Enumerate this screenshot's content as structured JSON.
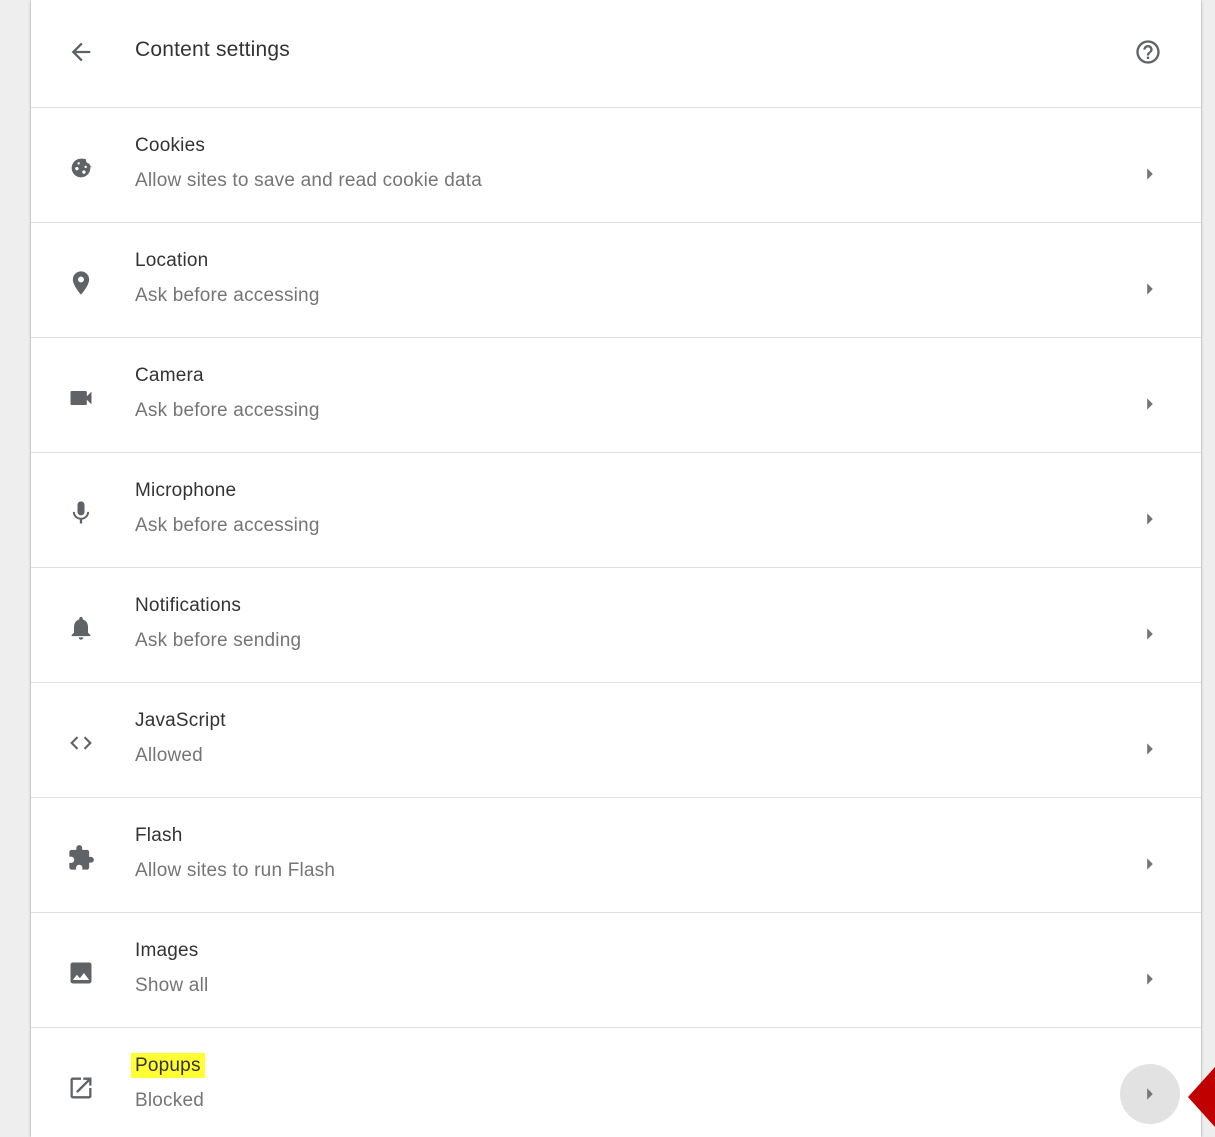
{
  "header": {
    "title": "Content settings",
    "back_icon": "arrow-back-icon",
    "help_icon": "help-circle-icon"
  },
  "rows": [
    {
      "title": "Cookies",
      "subtitle": "Allow sites to save and read cookie data",
      "icon": "cookie-icon"
    },
    {
      "title": "Location",
      "subtitle": "Ask before accessing",
      "icon": "location-pin-icon"
    },
    {
      "title": "Camera",
      "subtitle": "Ask before accessing",
      "icon": "camera-icon"
    },
    {
      "title": "Microphone",
      "subtitle": "Ask before accessing",
      "icon": "microphone-icon"
    },
    {
      "title": "Notifications",
      "subtitle": "Ask before sending",
      "icon": "bell-icon"
    },
    {
      "title": "JavaScript",
      "subtitle": "Allowed",
      "icon": "code-icon"
    },
    {
      "title": "Flash",
      "subtitle": "Allow sites to run Flash",
      "icon": "puzzle-icon"
    },
    {
      "title": "Images",
      "subtitle": "Show all",
      "icon": "image-icon"
    },
    {
      "title": "Popups",
      "subtitle": "Blocked",
      "icon": "open-in-new-icon"
    }
  ],
  "colors": {
    "highlight": "#ffff33",
    "annotation": "#c00000",
    "icon": "#5f6368"
  }
}
